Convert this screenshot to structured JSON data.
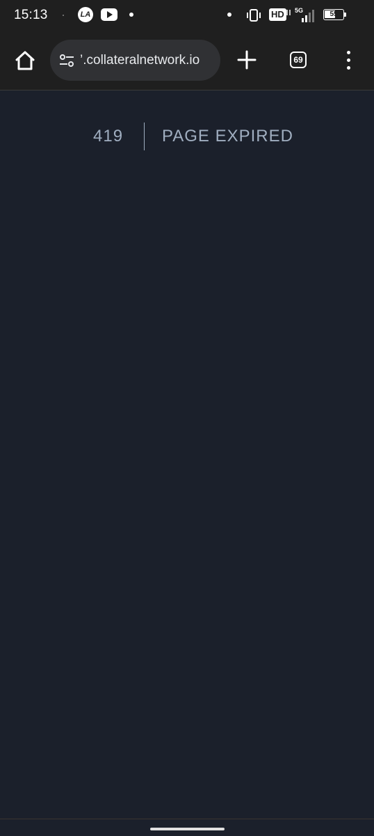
{
  "status_bar": {
    "time": "15:13",
    "app_icon_text": "LA",
    "hd_label": "HD",
    "network_label": "5G",
    "battery_level": "55",
    "icons": [
      "la-app-icon",
      "youtube-icon",
      "notification-dot-icon",
      "vibrate-icon",
      "hd-voice-icon",
      "signal-icon",
      "battery-icon"
    ]
  },
  "browser": {
    "url": "’.collateralnetwork.io",
    "tab_count": "69",
    "icons": [
      "home-icon",
      "site-settings-icon",
      "new-tab-icon",
      "tab-switcher-icon",
      "overflow-menu-icon"
    ]
  },
  "page": {
    "error_code": "419",
    "error_message": "PAGE EXPIRED"
  },
  "colors": {
    "page_background": "#1b202b",
    "chrome_background": "#1f1f1f",
    "error_text": "#a0aec0"
  }
}
